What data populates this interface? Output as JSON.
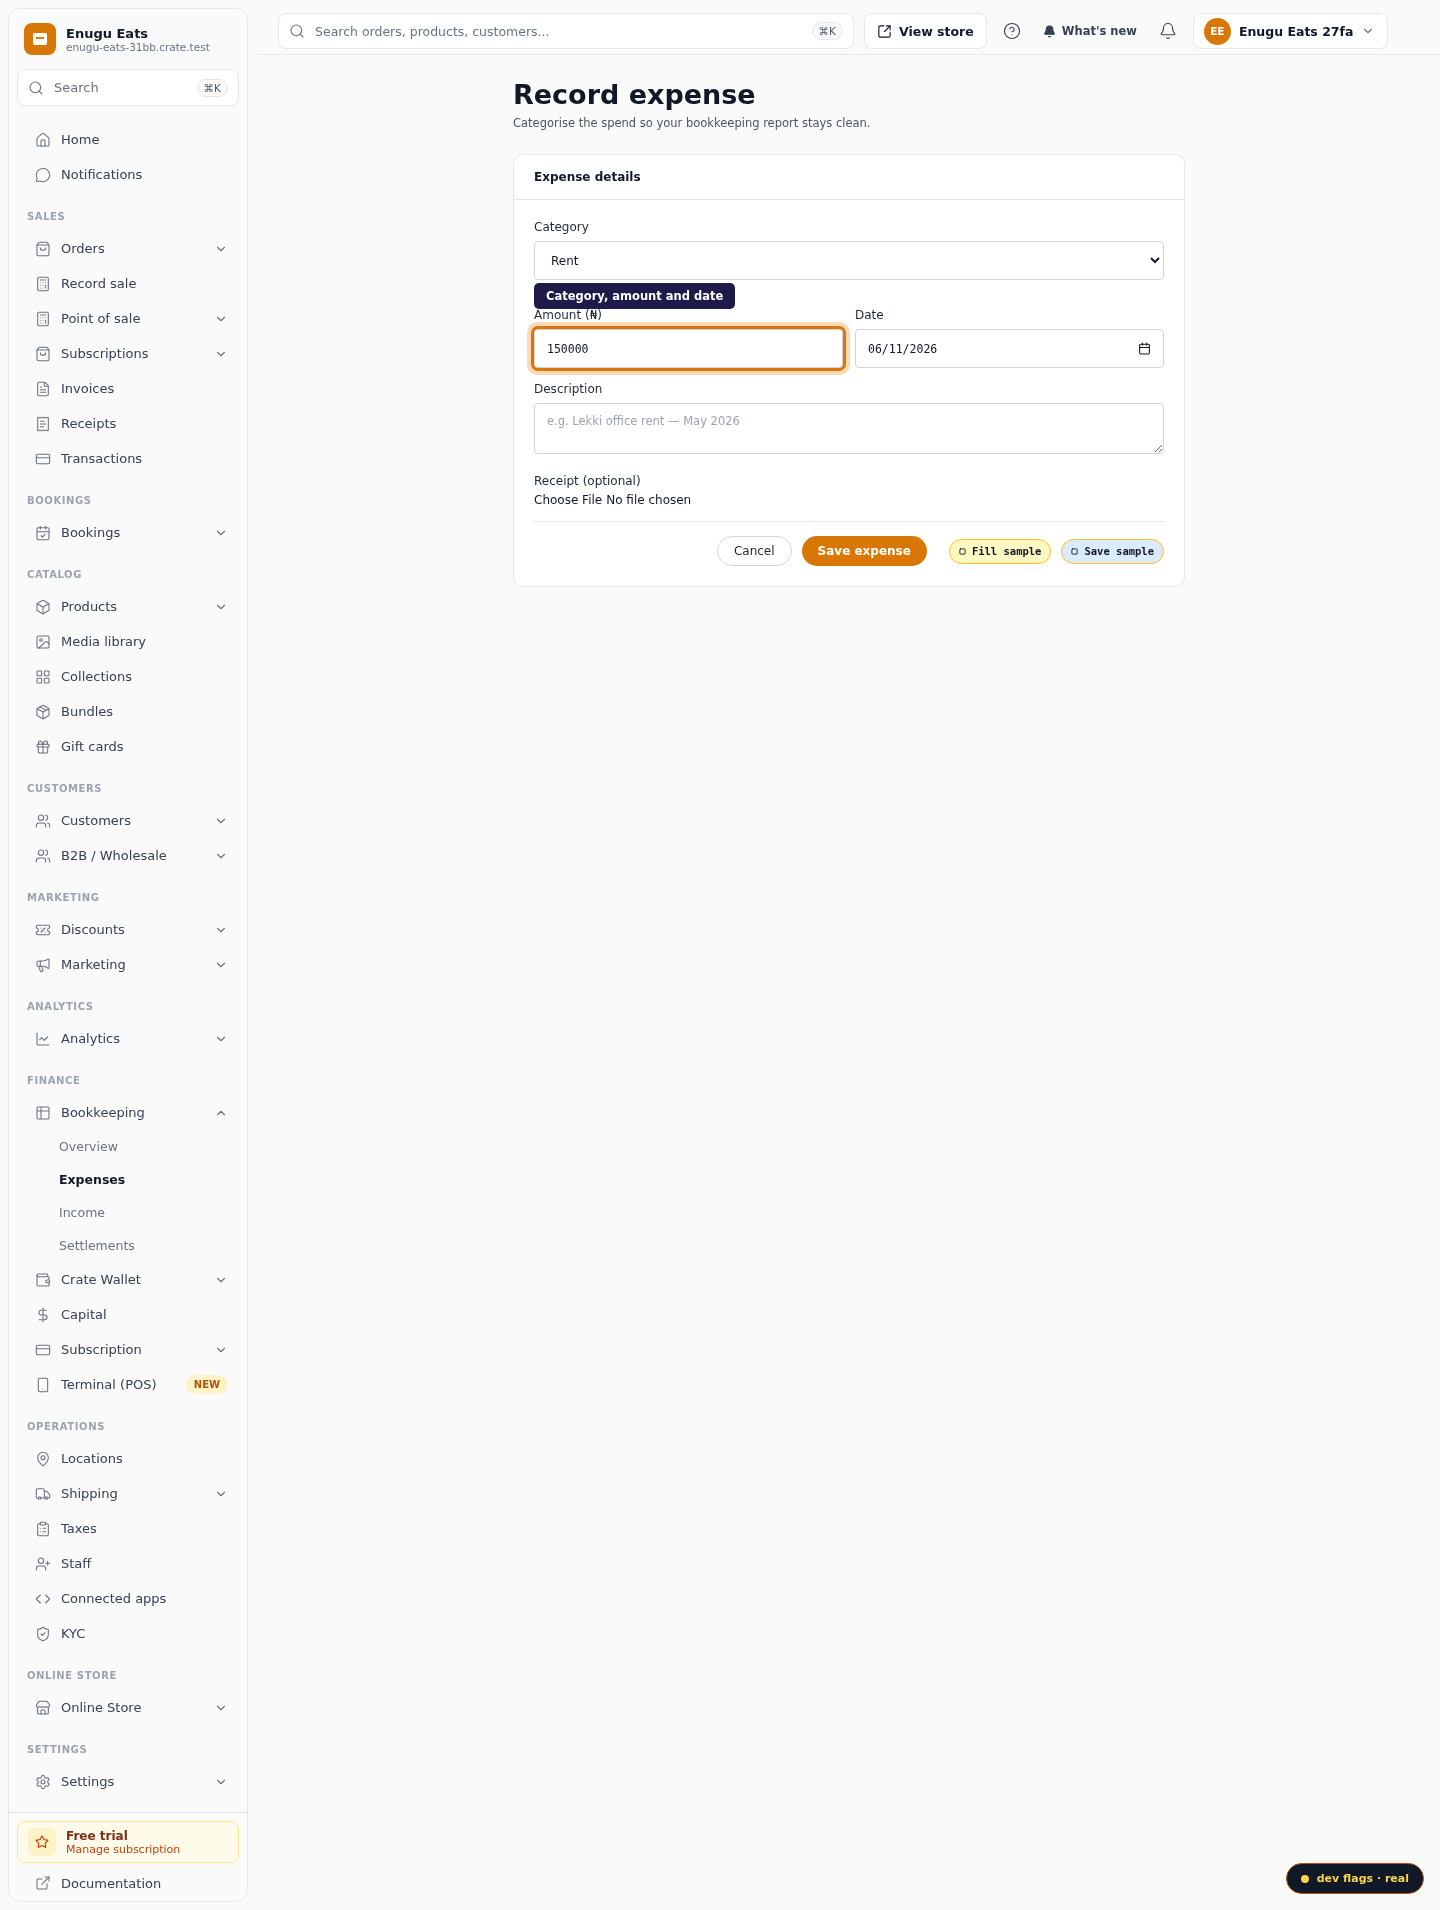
{
  "sidebar": {
    "brand": {
      "name": "Enugu Eats",
      "domain": "enugu-eats-31bb.crate.test"
    },
    "search": {
      "placeholder": "Search",
      "shortcut": "⌘K"
    },
    "sections": [
      {
        "items": [
          {
            "label": "Home",
            "expandable": false
          },
          {
            "label": "Notifications",
            "expandable": false
          }
        ]
      },
      {
        "title": "SALES",
        "items": [
          {
            "label": "Orders",
            "expandable": true,
            "expanded": false
          },
          {
            "label": "Record sale",
            "expandable": false
          },
          {
            "label": "Point of sale",
            "expandable": true,
            "expanded": false
          },
          {
            "label": "Subscriptions",
            "expandable": true,
            "expanded": false
          },
          {
            "label": "Invoices",
            "expandable": false
          },
          {
            "label": "Receipts",
            "expandable": false
          },
          {
            "label": "Transactions",
            "expandable": false
          }
        ]
      },
      {
        "title": "BOOKINGS",
        "items": [
          {
            "label": "Bookings",
            "expandable": true,
            "expanded": false
          }
        ]
      },
      {
        "title": "CATALOG",
        "items": [
          {
            "label": "Products",
            "expandable": true,
            "expanded": false
          },
          {
            "label": "Media library",
            "expandable": false
          },
          {
            "label": "Collections",
            "expandable": false
          },
          {
            "label": "Bundles",
            "expandable": false
          },
          {
            "label": "Gift cards",
            "expandable": false
          }
        ]
      },
      {
        "title": "CUSTOMERS",
        "items": [
          {
            "label": "Customers",
            "expandable": true,
            "expanded": false
          },
          {
            "label": "B2B / Wholesale",
            "expandable": true,
            "expanded": false
          }
        ]
      },
      {
        "title": "MARKETING",
        "items": [
          {
            "label": "Discounts",
            "expandable": true,
            "expanded": false
          },
          {
            "label": "Marketing",
            "expandable": true,
            "expanded": false
          }
        ]
      },
      {
        "title": "ANALYTICS",
        "items": [
          {
            "label": "Analytics",
            "expandable": true,
            "expanded": false
          }
        ]
      },
      {
        "title": "FINANCE",
        "items": [
          {
            "label": "Bookkeeping",
            "expandable": true,
            "expanded": true,
            "children": [
              {
                "label": "Overview",
                "selected": false
              },
              {
                "label": "Expenses",
                "selected": true
              },
              {
                "label": "Income",
                "selected": false
              },
              {
                "label": "Settlements",
                "selected": false
              }
            ]
          },
          {
            "label": "Crate Wallet",
            "expandable": true,
            "expanded": false
          },
          {
            "label": "Capital",
            "expandable": false
          },
          {
            "label": "Subscription",
            "expandable": true,
            "expanded": false
          },
          {
            "label": "Terminal (POS)",
            "expandable": false,
            "badge": "NEW"
          }
        ]
      },
      {
        "title": "OPERATIONS",
        "items": [
          {
            "label": "Locations",
            "expandable": false
          },
          {
            "label": "Shipping",
            "expandable": true,
            "expanded": false
          },
          {
            "label": "Taxes",
            "expandable": false
          },
          {
            "label": "Staff",
            "expandable": false
          },
          {
            "label": "Connected apps",
            "expandable": false
          },
          {
            "label": "KYC",
            "expandable": false
          }
        ]
      },
      {
        "title": "ONLINE STORE",
        "items": [
          {
            "label": "Online Store",
            "expandable": true,
            "expanded": false
          }
        ]
      },
      {
        "title": "SETTINGS",
        "items": [
          {
            "label": "Settings",
            "expandable": true,
            "expanded": false
          }
        ]
      }
    ],
    "trial": {
      "title": "Free trial",
      "subtitle": "Manage subscription"
    },
    "documentation": "Documentation"
  },
  "topbar": {
    "search": {
      "placeholder": "Search orders, products, customers...",
      "shortcut": "⌘K"
    },
    "view_store": "View store",
    "whats_new": "What's new",
    "account": {
      "initials": "EE",
      "name": "Enugu Eats 27fa"
    }
  },
  "page": {
    "title": "Record expense",
    "subtitle": "Categorise the spend so your bookkeeping report stays clean.",
    "card": {
      "title": "Expense details",
      "category": {
        "label": "Category",
        "value": "Rent"
      },
      "tooltip": "Category, amount and date",
      "amount": {
        "label": "Amount (₦)",
        "value": "150000",
        "focused": true
      },
      "date": {
        "label": "Date",
        "value": "06/11/2026"
      },
      "description": {
        "label": "Description",
        "placeholder": "e.g. Lekki office rent — May 2026"
      },
      "receipt": {
        "label": "Receipt (optional)",
        "button": "Choose File",
        "status": "No file chosen"
      },
      "buttons": {
        "cancel": "Cancel",
        "save": "Save expense",
        "fill_sample": "Fill sample",
        "save_sample": "Save sample"
      }
    }
  },
  "dev_flags": "dev flags · real"
}
